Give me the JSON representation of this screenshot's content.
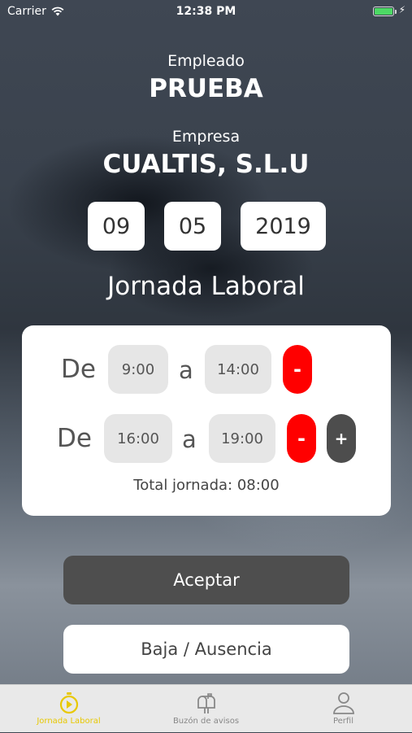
{
  "status_bar": {
    "carrier": "Carrier",
    "time": "12:38 PM"
  },
  "employee": {
    "label": "Empleado",
    "value": "PRUEBA"
  },
  "company": {
    "label": "Empresa",
    "value": "CUALTIS, S.L.U"
  },
  "date": {
    "day": "09",
    "month": "05",
    "year": "2019"
  },
  "section_title": "Jornada Laboral",
  "shifts": [
    {
      "from_label": "De",
      "from": "9:00",
      "to_label": "a",
      "to": "14:00",
      "remove_label": "-"
    },
    {
      "from_label": "De",
      "from": "16:00",
      "to_label": "a",
      "to": "19:00",
      "remove_label": "-",
      "add_label": "+"
    }
  ],
  "total_text": "Total jornada: 08:00",
  "buttons": {
    "accept": "Aceptar",
    "absence": "Baja / Ausencia"
  },
  "tabs": [
    {
      "label": "Jornada Laboral",
      "icon": "stopwatch-icon",
      "active": true
    },
    {
      "label": "Buzón de avisos",
      "icon": "mailbox-icon",
      "active": false
    },
    {
      "label": "Perfil",
      "icon": "user-icon",
      "active": false
    }
  ],
  "colors": {
    "accent": "#e8c800",
    "danger": "#ff0000",
    "dark_button": "#4e4e4e",
    "battery": "#4cd964"
  }
}
